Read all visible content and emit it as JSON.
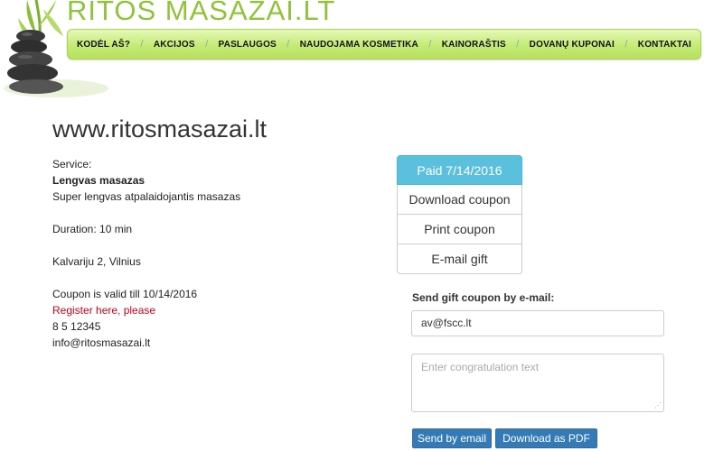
{
  "header": {
    "logo_text": "RITOS MASAZAI.LT",
    "nav": [
      {
        "label": "KODĖL AŠ?"
      },
      {
        "label": "AKCIJOS"
      },
      {
        "label": "PASLAUGOS"
      },
      {
        "label": "NAUDOJAMA KOSMETIKA"
      },
      {
        "label": "KAINORAŠTIS"
      },
      {
        "label": "DOVANŲ KUPONAI"
      },
      {
        "label": "KONTAKTAI"
      }
    ],
    "nav_separator": "/"
  },
  "main": {
    "site_title": "www.ritosmasazai.lt",
    "service_label": "Service:",
    "service_name": "Lengvas masazas",
    "service_desc": "Super lengvas atpalaidojantis masazas",
    "duration": "Duration: 10 min",
    "address": "Kalvariju 2, Vilnius",
    "valid_till": "Coupon is valid till 10/14/2016",
    "register_link": "Register here, please",
    "phone": "8 5 12345",
    "email": "info@ritosmasazai.lt"
  },
  "coupon_actions": {
    "paid_label": "Paid 7/14/2016",
    "download_coupon": "Download coupon",
    "print_coupon": "Print coupon",
    "email_gift": "E-mail gift"
  },
  "email_form": {
    "label": "Send gift coupon by e-mail:",
    "email_value": "av@fscc.lt",
    "congrats_placeholder": "Enter congratulation text",
    "send_button": "Send by email",
    "pdf_button": "Download as PDF"
  },
  "colors": {
    "nav_green": "#c7ec7a",
    "logo_green": "#8fc43a",
    "paid_blue": "#5bc0de",
    "primary_blue": "#337ab7",
    "register_red": "#d0021b"
  }
}
